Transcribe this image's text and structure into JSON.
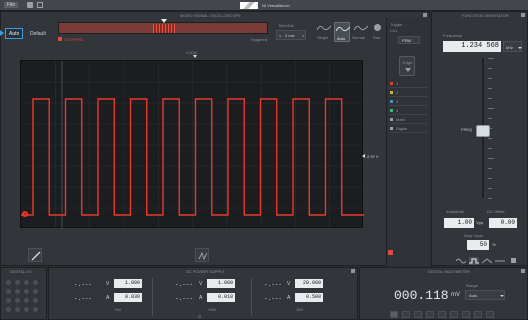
{
  "titlebar": {
    "file_menu": "File",
    "app_title": "NI VirtualBench"
  },
  "scope": {
    "header": "MIXED SIGNAL OSCILLOSCOPE",
    "auto_label": "Auto",
    "default_label": "Default",
    "status_text": "STOPPED",
    "timediv_label": "Time/Div",
    "timediv_value": "2 ms/",
    "triggered_label": "Triggered",
    "mode_labels": [
      "Single",
      "Auto",
      "Normal",
      "Run"
    ],
    "trigger_label": "Trigger",
    "trigger_mode": "Ch1",
    "trigger_edge_label": "Edge",
    "trigger_value": "FSW",
    "ch1_marker": "1",
    "trig_level": "2.97 V",
    "channel_labels": [
      "1",
      "2",
      "3",
      "4",
      "Math",
      "Digital"
    ],
    "signal": {
      "type": "square",
      "color": "#e8392b",
      "cycles": 10,
      "high_frac": 0.5,
      "vertical_divisions": 8,
      "horizontal_divisions": 10
    }
  },
  "fgen": {
    "header": "FUNCTION GENERATOR",
    "freq_label": "Frequency",
    "freq_value": "1.234 568",
    "freq_unit": "kHz",
    "amplitude_label": "Amplitude",
    "amplitude_value": "1.00",
    "amplitude_unit": "Vpp",
    "dc_offset_label": "DC Offset",
    "dc_offset_value": "0.00",
    "duty_label": "Duty Cycle",
    "duty_value": "50",
    "duty_unit": "%",
    "knob_label": "FREQ"
  },
  "digital_io": {
    "header": "DIGITAL I/O"
  },
  "power": {
    "header": "DC POWER SUPPLY",
    "channels": [
      {
        "v": "1.000",
        "a": "0.030",
        "name": "+6V",
        "meas_v": "-.---",
        "meas_a": "-.---"
      },
      {
        "v": "1.000",
        "a": "0.010",
        "name": "+25V",
        "meas_v": "-.---",
        "meas_a": "-.---"
      },
      {
        "v": "20.000",
        "a": "0.500",
        "name": "-25V",
        "meas_v": "-.---",
        "meas_a": "-.---"
      }
    ],
    "v_unit": "V",
    "a_unit": "A"
  },
  "dmm": {
    "header": "DIGITAL MULTIMETER",
    "value": "000.118",
    "unit": "mV",
    "range_label": "Range",
    "range_value": "Auto"
  }
}
